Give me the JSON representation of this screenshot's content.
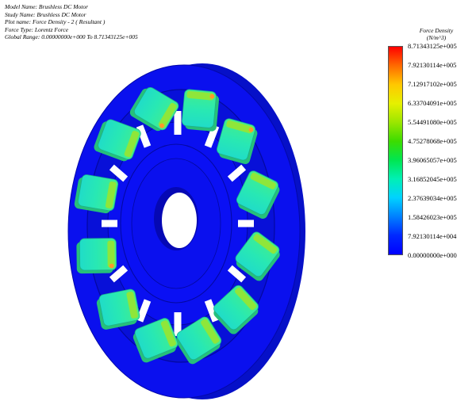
{
  "plot_info": {
    "model_name": "Model Name: Brushless DC Motor",
    "study_name": "Study Name: Brushless DC Motor",
    "plot_name": "Plot name: Force Density  - 2 ( Resultant )",
    "force_type": "Force Type: Lorentz Force",
    "global_range": "Global Range:  0.00000000e+000 To 8.71343125e+005"
  },
  "legend": {
    "title_line1": "Force Density",
    "title_line2": "(N/m^3)",
    "values": [
      "8.71343125e+005",
      "7.92130114e+005",
      "7.12917102e+005",
      "6.33704091e+005",
      "5.54491080e+005",
      "4.75278068e+005",
      "3.96065057e+005",
      "3.16852045e+005",
      "2.37639034e+005",
      "1.58426023e+005",
      "7.92130114e+004",
      "0.00000000e+000"
    ],
    "colors": [
      "#ff0000",
      "#ff6a00",
      "#ffc800",
      "#e6f000",
      "#9be600",
      "#3cdc00",
      "#00e650",
      "#00f0b4",
      "#00d2ff",
      "#0080ff",
      "#0028ff",
      "#0000ff"
    ]
  },
  "model_colors": {
    "body": "#0a10ee",
    "body_dark": "#0508b4",
    "body_side": "#0810cc",
    "magnet_low": "#1ee1c8",
    "magnet_mid": "#36ef8a",
    "magnet_high": "#8fe63a",
    "hot_spot": "#ff9a2a"
  }
}
